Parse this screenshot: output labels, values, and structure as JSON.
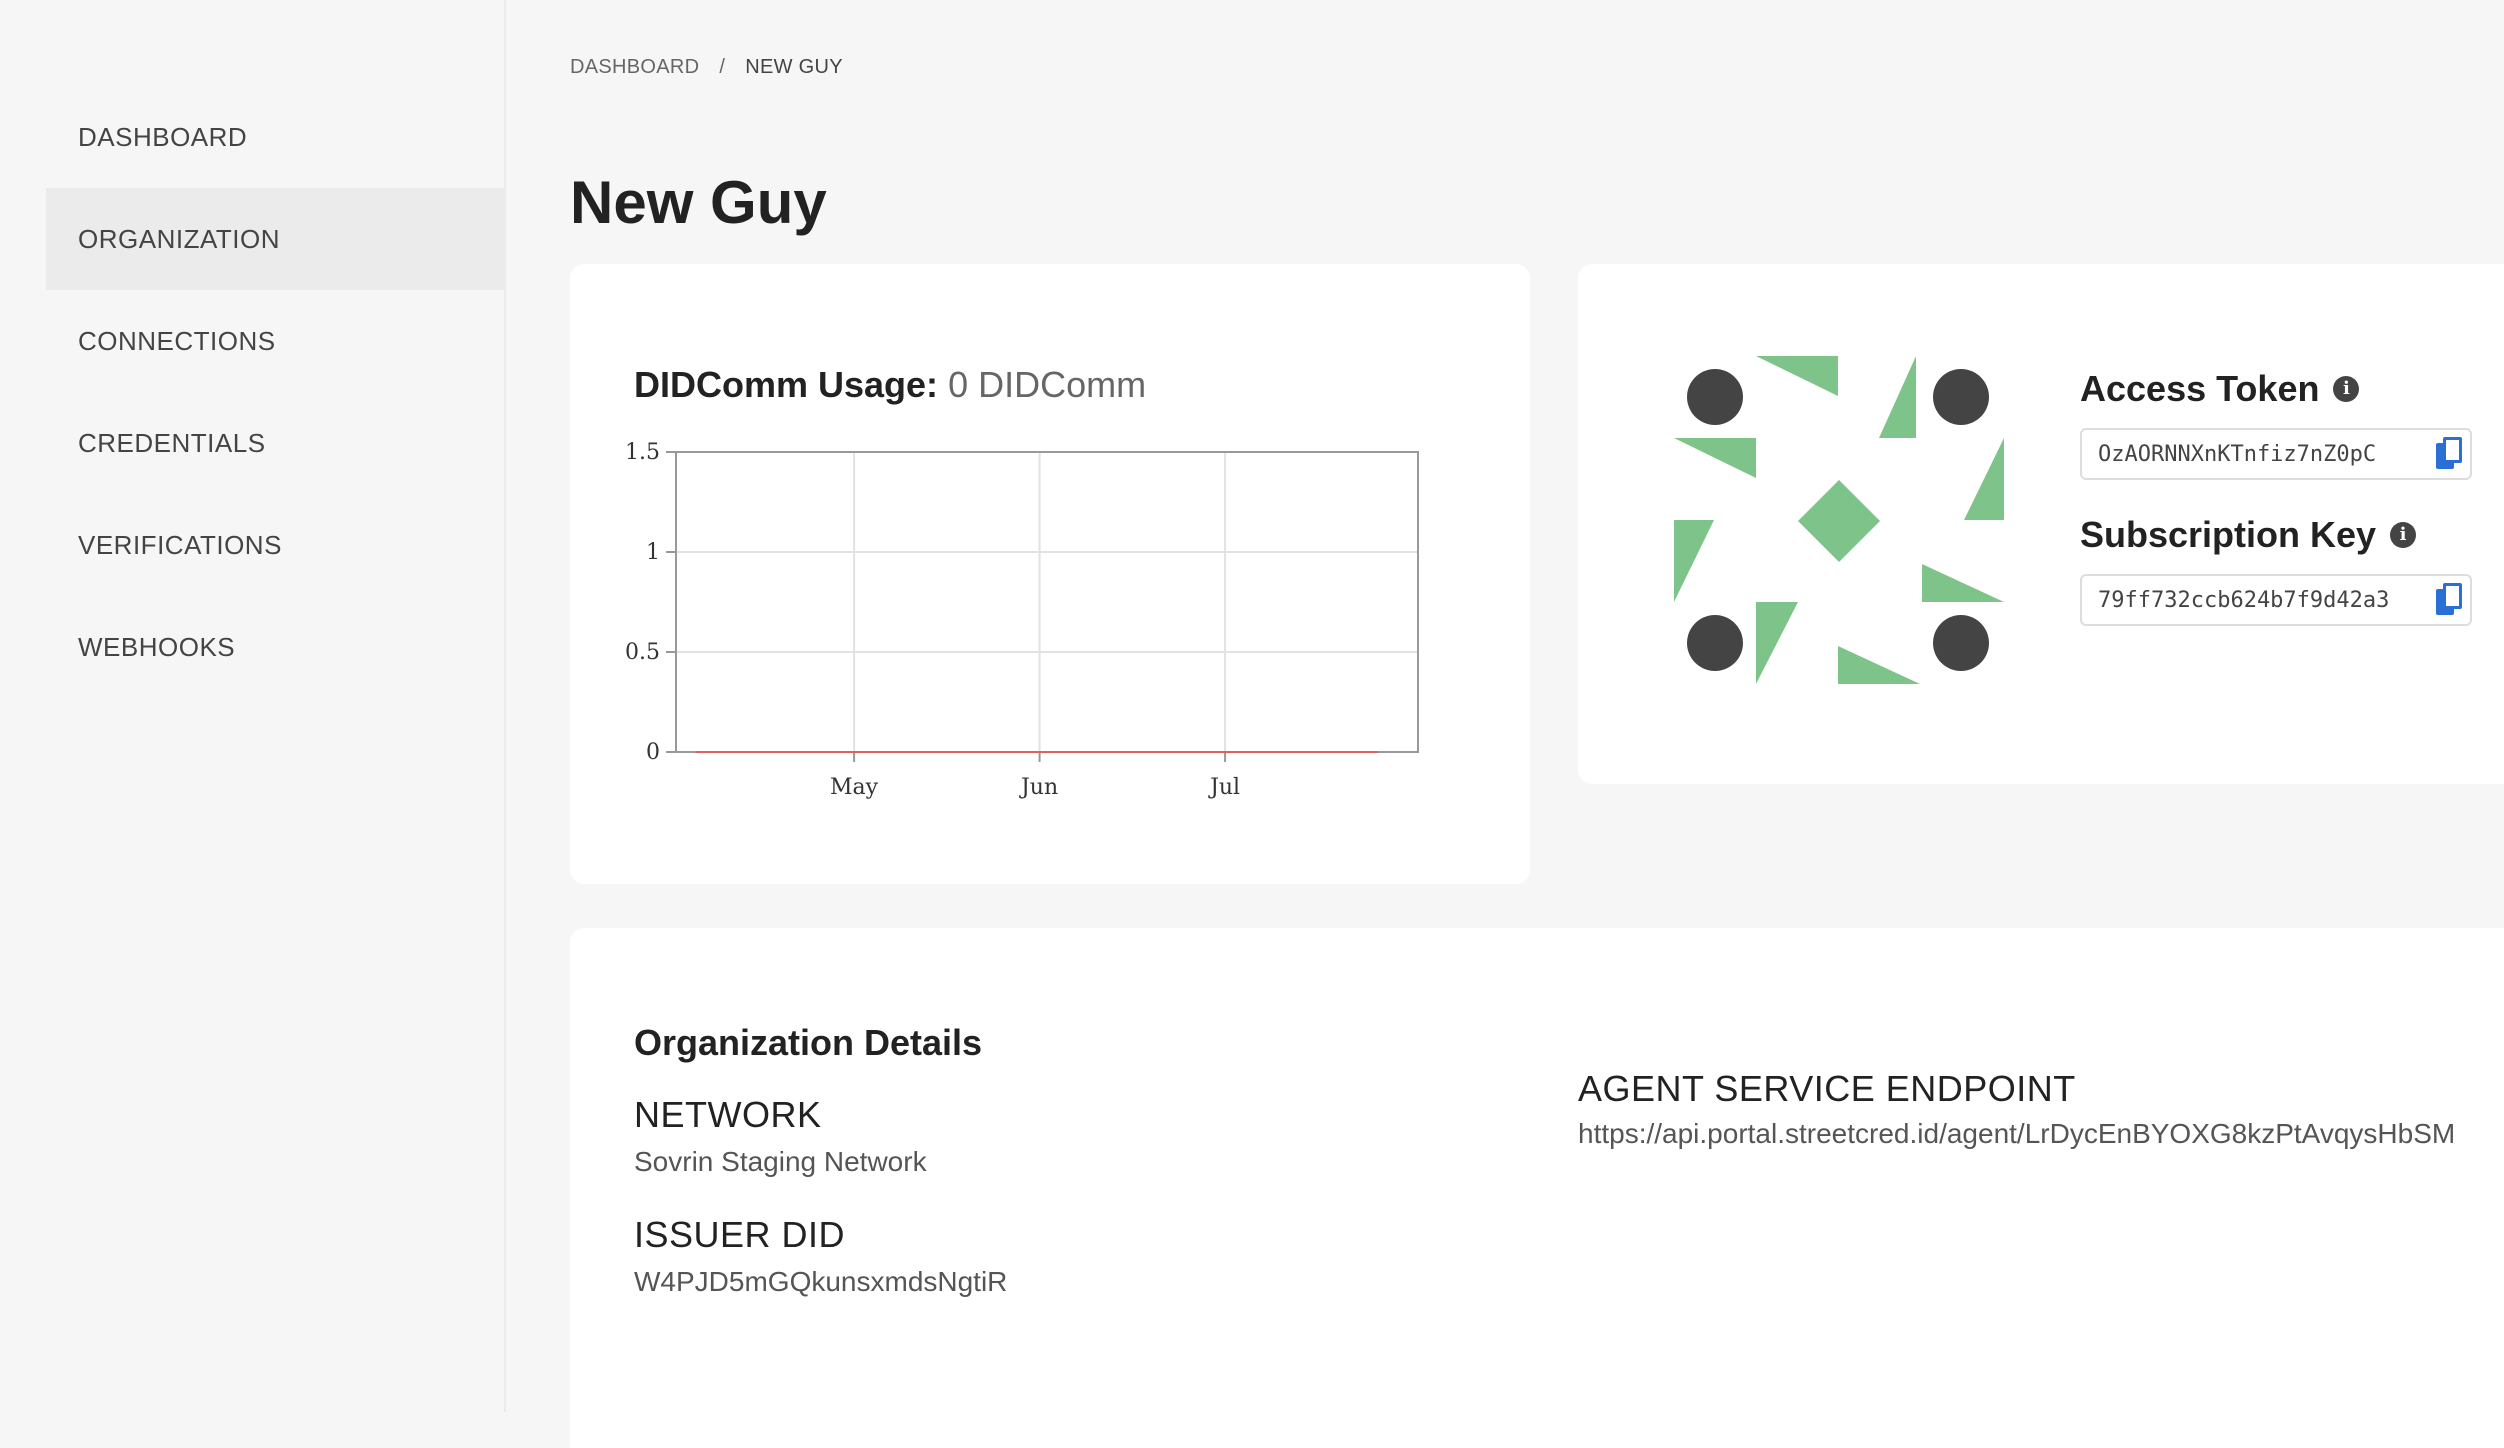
{
  "sidebar": {
    "items": [
      {
        "label": "DASHBOARD",
        "active": false
      },
      {
        "label": "ORGANIZATION",
        "active": true
      },
      {
        "label": "CONNECTIONS",
        "active": false
      },
      {
        "label": "CREDENTIALS",
        "active": false
      },
      {
        "label": "VERIFICATIONS",
        "active": false
      },
      {
        "label": "WEBHOOKS",
        "active": false
      }
    ]
  },
  "breadcrumb": {
    "root": "DASHBOARD",
    "separator": "/",
    "current": "NEW GUY"
  },
  "page": {
    "title": "New Guy"
  },
  "usage": {
    "title_label": "DIDComm Usage:",
    "title_value": "0 DIDComm"
  },
  "chart_data": {
    "type": "line",
    "title": "",
    "xlabel": "",
    "ylabel": "",
    "x_tick_labels": [
      "May",
      "Jun",
      "Jul"
    ],
    "y_tick_labels": [
      "0",
      "0.5",
      "1",
      "1.5"
    ],
    "ylim": [
      0,
      1.5
    ],
    "grid": true,
    "series": [
      {
        "values": [
          0,
          0,
          0,
          0,
          0,
          0,
          0,
          0,
          0,
          0,
          0,
          0,
          0,
          0
        ],
        "color": "#e06060"
      }
    ]
  },
  "tokens": {
    "access_token_label": "Access Token",
    "access_token_value": "OzAORNNXnKTnfiz7nZ0pC",
    "subscription_key_label": "Subscription Key",
    "subscription_key_value": "79ff732ccb624b7f9d42a3"
  },
  "details": {
    "title": "Organization Details",
    "network_label": "NETWORK",
    "network_value": "Sovrin Staging Network",
    "issuer_did_label": "ISSUER DID",
    "issuer_did_value": "W4PJD5mGQkunsxmdsNgtiR",
    "endpoint_label": "AGENT SERVICE ENDPOINT",
    "endpoint_value": "https://api.portal.streetcred.id/agent/LrDycEnBYOXG8kzPtAvqysHbSM"
  },
  "colors": {
    "identicon_green": "#7ec48a",
    "identicon_dark": "#444444",
    "copy_icon": "#2a6fd6",
    "series_line": "#e06060"
  }
}
